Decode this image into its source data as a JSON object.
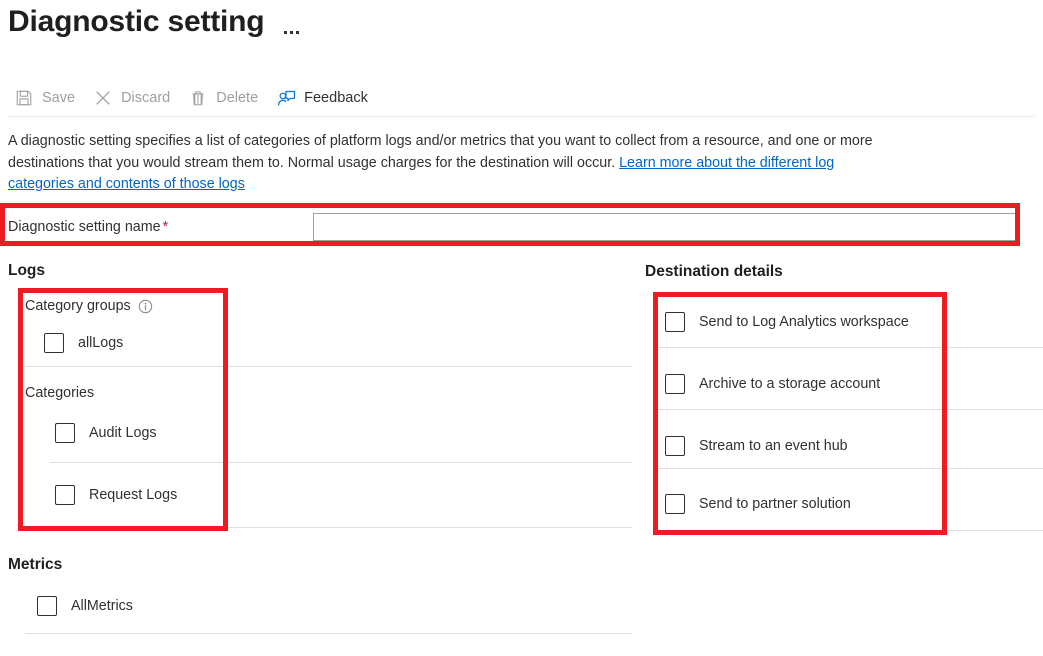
{
  "header": {
    "title": "Diagnostic setting",
    "more_menu_icon": "ellipsis-icon"
  },
  "toolbar": {
    "items": [
      {
        "label": "Save",
        "icon": "save-icon",
        "enabled": false
      },
      {
        "label": "Discard",
        "icon": "discard-icon",
        "enabled": false
      },
      {
        "label": "Delete",
        "icon": "delete-icon",
        "enabled": false
      },
      {
        "label": "Feedback",
        "icon": "feedback-icon",
        "enabled": true
      }
    ]
  },
  "description": {
    "text": "A diagnostic setting specifies a list of categories of platform logs and/or metrics that you want to collect from a resource, and one or more destinations that you would stream them to. Normal usage charges for the destination will occur. ",
    "link_text": "Learn more about the different log categories and contents of those logs"
  },
  "name_field": {
    "label": "Diagnostic setting name",
    "required_marker": "*",
    "value": "",
    "placeholder": ""
  },
  "logs": {
    "heading": "Logs",
    "category_groups_label": "Category groups",
    "category_groups_info_icon": "info-icon",
    "category_groups": [
      {
        "label": "allLogs",
        "checked": false
      }
    ],
    "categories_label": "Categories",
    "categories": [
      {
        "label": "Audit Logs",
        "checked": false
      },
      {
        "label": "Request Logs",
        "checked": false
      }
    ]
  },
  "metrics": {
    "heading": "Metrics",
    "items": [
      {
        "label": "AllMetrics",
        "checked": false
      }
    ]
  },
  "destination": {
    "heading": "Destination details",
    "options": [
      {
        "label": "Send to Log Analytics workspace",
        "checked": false
      },
      {
        "label": "Archive to a storage account",
        "checked": false
      },
      {
        "label": "Stream to an event hub",
        "checked": false
      },
      {
        "label": "Send to partner solution",
        "checked": false
      }
    ]
  },
  "annotations": {
    "color": "#ed1c24",
    "boxes": [
      {
        "name": "diagnostic-setting-name-highlight"
      },
      {
        "name": "logs-categories-highlight"
      },
      {
        "name": "destination-details-highlight"
      }
    ]
  },
  "colors": {
    "link": "#0066cc",
    "required": "#a4262c",
    "disabled_text": "#a19f9d",
    "text": "#323130",
    "divider": "#e1dfdd",
    "annotation_red": "#ed1c24"
  }
}
